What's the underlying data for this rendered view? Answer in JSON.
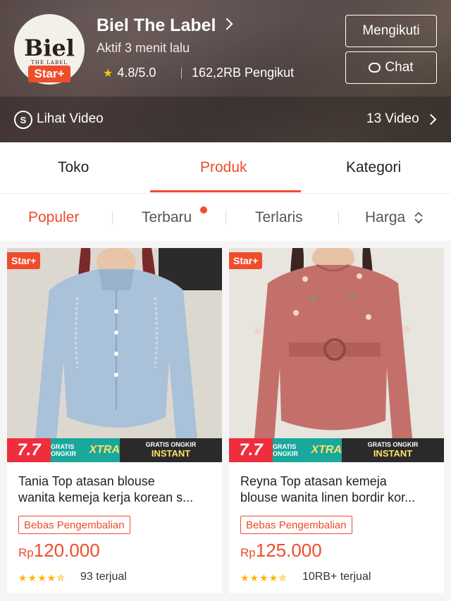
{
  "shop": {
    "logo_text": "Biel",
    "logo_subtext": "THE LABEL",
    "star_badge": "Star+",
    "name": "Biel The Label",
    "active": "Aktif 3 menit lalu",
    "rating": "4.8/5.0",
    "followers": "162,2RB Pengikut",
    "follow_button": "Mengikuti",
    "chat_button": "Chat"
  },
  "video": {
    "label": "Lihat Video",
    "count": "13 Video"
  },
  "tabs": [
    {
      "label": "Toko",
      "active": false
    },
    {
      "label": "Produk",
      "active": true
    },
    {
      "label": "Kategori",
      "active": false
    }
  ],
  "sort": [
    {
      "label": "Populer",
      "active": true
    },
    {
      "label": "Terbaru",
      "active": false,
      "dot": true
    },
    {
      "label": "Terlaris",
      "active": false
    },
    {
      "label": "Harga",
      "active": false
    }
  ],
  "products": [
    {
      "badge": "Star+",
      "promo_77": "7.7",
      "promo_xtra_small": "GRATIS ONGKIR",
      "promo_xtra": "XTRA",
      "promo_instant_small": "GRATIS ONGKIR",
      "promo_instant": "INSTANT",
      "title_line1": "Tania Top atasan blouse",
      "title_line2": "wanita kemeja kerja korean s...",
      "tag": "Bebas Pengembalian",
      "currency": "Rp",
      "price": "120.000",
      "rating": 4.5,
      "sold": "93 terjual"
    },
    {
      "badge": "Star+",
      "promo_77": "7.7",
      "promo_xtra_small": "GRATIS ONGKIR",
      "promo_xtra": "XTRA",
      "promo_instant_small": "GRATIS ONGKIR",
      "promo_instant": "INSTANT",
      "title_line1": "Reyna Top atasan kemeja",
      "title_line2": "blouse wanita linen bordir kor...",
      "tag": "Bebas Pengembalian",
      "currency": "Rp",
      "price": "125.000",
      "rating": 4.5,
      "sold": "10RB+ terjual"
    }
  ],
  "colors": {
    "accent": "#ee4d2d",
    "star": "#ffb400"
  }
}
